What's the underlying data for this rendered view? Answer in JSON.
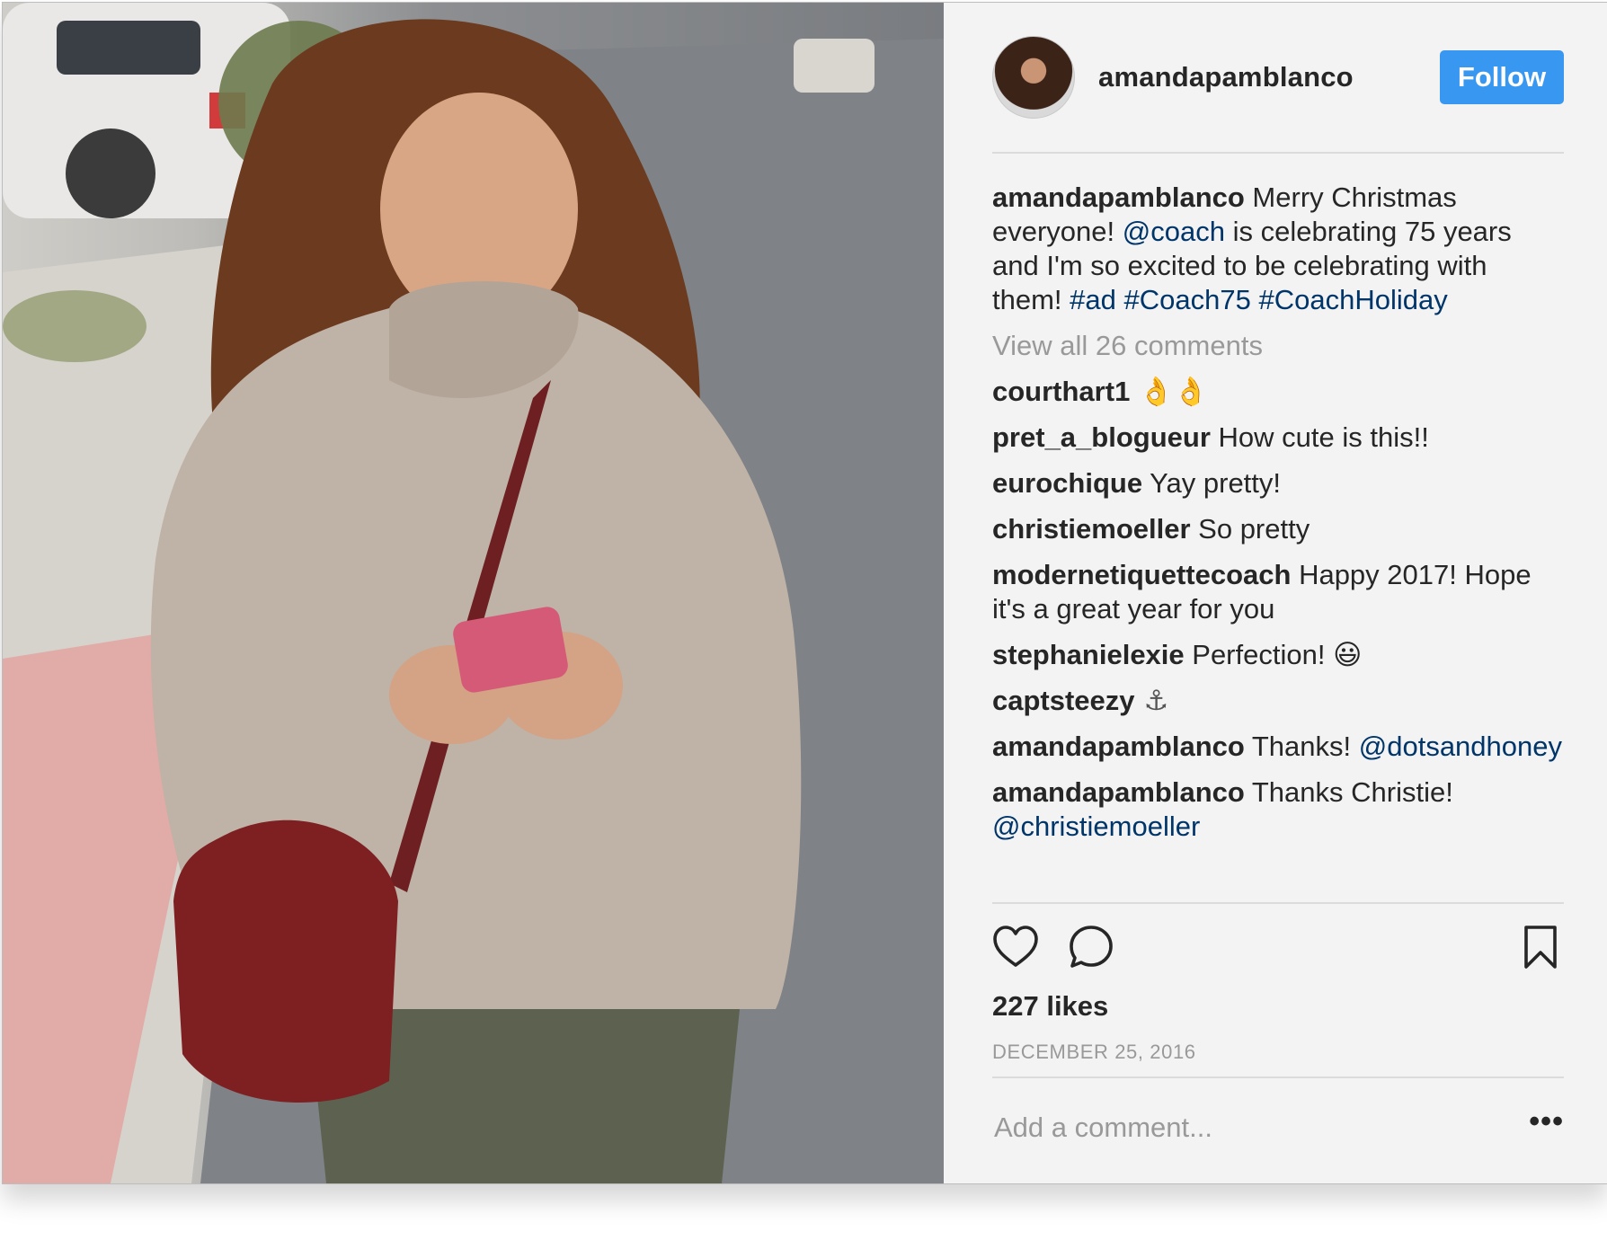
{
  "post": {
    "username": "amandapamblanco",
    "follow_label": "Follow",
    "caption": {
      "user": "amandapamblanco",
      "text_1": " Merry Christmas everyone! ",
      "mention": "@coach",
      "text_2": " is celebrating 75 years and I'm so excited to be celebrating with them! ",
      "tag_1": "#ad",
      "tag_2": "#Coach75",
      "tag_3": "#CoachHoliday"
    },
    "view_all": "View all 26 comments",
    "comments": [
      {
        "user": "courthart1",
        "text": " 👌👌"
      },
      {
        "user": "pret_a_blogueur",
        "text": " How cute is this!!"
      },
      {
        "user": "eurochique",
        "text": " Yay pretty!"
      },
      {
        "user": "christiemoeller",
        "text": " So pretty"
      },
      {
        "user": "modernetiquettecoach",
        "text": " Happy 2017! Hope it's a great year for you"
      },
      {
        "user": "stephanielexie",
        "text": " Perfection! 😃"
      },
      {
        "user": "captsteezy",
        "text": " ⚓"
      },
      {
        "user": "amandapamblanco",
        "text": " Thanks! ",
        "mention": "@dotsandhoney"
      },
      {
        "user": "amandapamblanco",
        "text": " Thanks Christie! ",
        "mention": "@christiemoeller"
      }
    ],
    "likes": "227 likes",
    "date": "DECEMBER 25, 2016",
    "add_comment_placeholder": "Add a comment...",
    "more_label": "•••",
    "icons": {
      "like": "heart-icon",
      "comment": "comment-bubble-icon",
      "save": "bookmark-icon"
    },
    "colors": {
      "follow_button": "#3897f0",
      "link": "#003569",
      "muted": "#999999",
      "text": "#262626"
    }
  }
}
